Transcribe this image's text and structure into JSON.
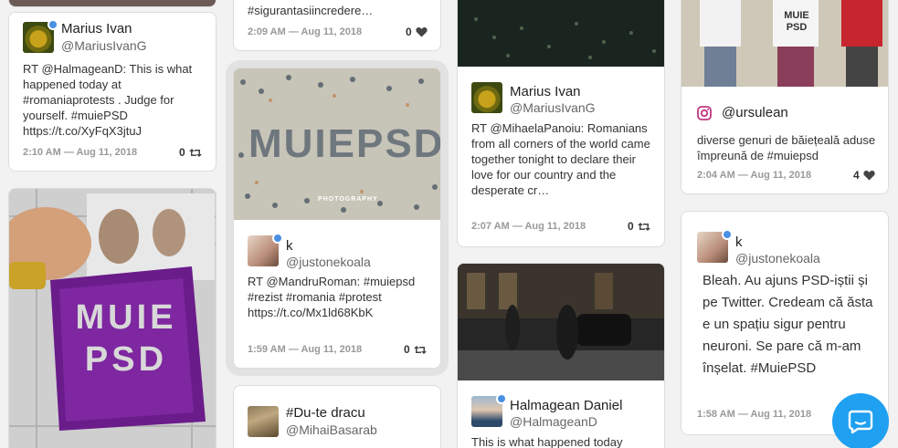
{
  "posts": {
    "c1_top": {
      "meta": ""
    },
    "c2_top": {
      "body_tail": "#sigurantasiincredere…",
      "meta": "2:09 AM — Aug 11, 2018",
      "count": "0"
    },
    "c1_a": {
      "name": "Marius Ivan",
      "handle": "@MariusIvanG",
      "body": "RT @HalmageanD: This is what happened today at #romaniaprotests . Judge for yourself. #muiePSD https://t.co/XyFqX3jtuJ",
      "meta": "2:10 AM — Aug 11, 2018",
      "count": "0"
    },
    "c1_b": {
      "media_alt": "MUIE PSD"
    },
    "c2_a": {
      "media_caption": "PHOTOGRAPHY",
      "name": "k",
      "handle": "@justonekoala",
      "body": "RT @MandruRoman: #muiepsd #rezist #romania #protest https://t.co/Mx1ld68KbK",
      "meta": "1:59 AM — Aug 11, 2018",
      "count": "0"
    },
    "c2_b": {
      "name": "#Du-te dracu",
      "handle": "@MihaiBasarab"
    },
    "c3_a": {
      "name": "Marius Ivan",
      "handle": "@MariusIvanG",
      "body": "RT @MihaelaPanoiu: Romanians from all corners of the world came together tonight to declare their love for our country and the desperate cr…",
      "meta": "2:07 AM — Aug 11, 2018",
      "count": "0"
    },
    "c3_b": {
      "name": "Halmagean Daniel",
      "handle": "@HalmageanD",
      "body": "This is what happened today"
    },
    "c4_a": {
      "shirt_text_1": "MUIE PSD",
      "name": "@ursulean",
      "body": "diverse genuri de băiețeală aduse împreună de #muiepsd",
      "meta": "2:04 AM — Aug 11, 2018",
      "count": "4"
    },
    "c4_b": {
      "name": "k",
      "handle": "@justonekoala",
      "body": "Bleah. Au ajuns PSD-iștii și pe Twitter. Credeam că ăsta e un spațiu sigur pentru neuroni. Se pare că m-am înșelat. #MuiePSD",
      "meta": "1:58 AM — Aug 11, 2018"
    }
  },
  "colors": {
    "accent": "#1fa0f0",
    "verified": "#4a90e2",
    "instagram": "#c13584"
  },
  "icons": {
    "retweet": "retweet-icon",
    "like": "heart-icon",
    "chat": "chat-icon",
    "instagram": "instagram-icon"
  }
}
